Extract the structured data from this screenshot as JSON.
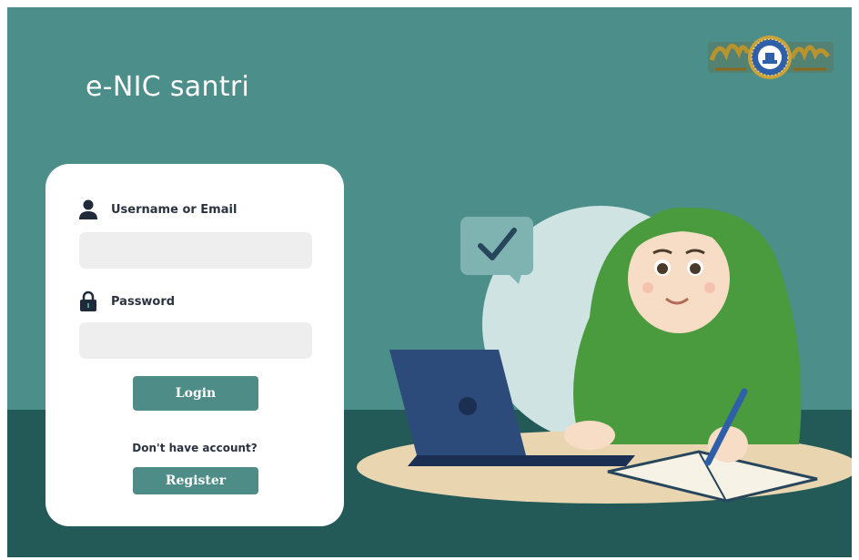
{
  "app": {
    "title": "e-NIC santri"
  },
  "login": {
    "username_label": "Username or Email",
    "username_value": "",
    "password_label": "Password",
    "password_value": "",
    "login_button": "Login",
    "no_account_text": "Don't have account?",
    "register_button": "Register"
  },
  "colors": {
    "background": "#4b8e8a",
    "floor": "#235a58",
    "button": "#4d8c87",
    "card": "#ffffff",
    "input": "#eeeeee"
  },
  "icons": {
    "username": "user-icon",
    "password": "lock-icon",
    "logo": "institution-logo",
    "illustration": "student-laptop-illustration",
    "check": "check-bubble-icon"
  }
}
